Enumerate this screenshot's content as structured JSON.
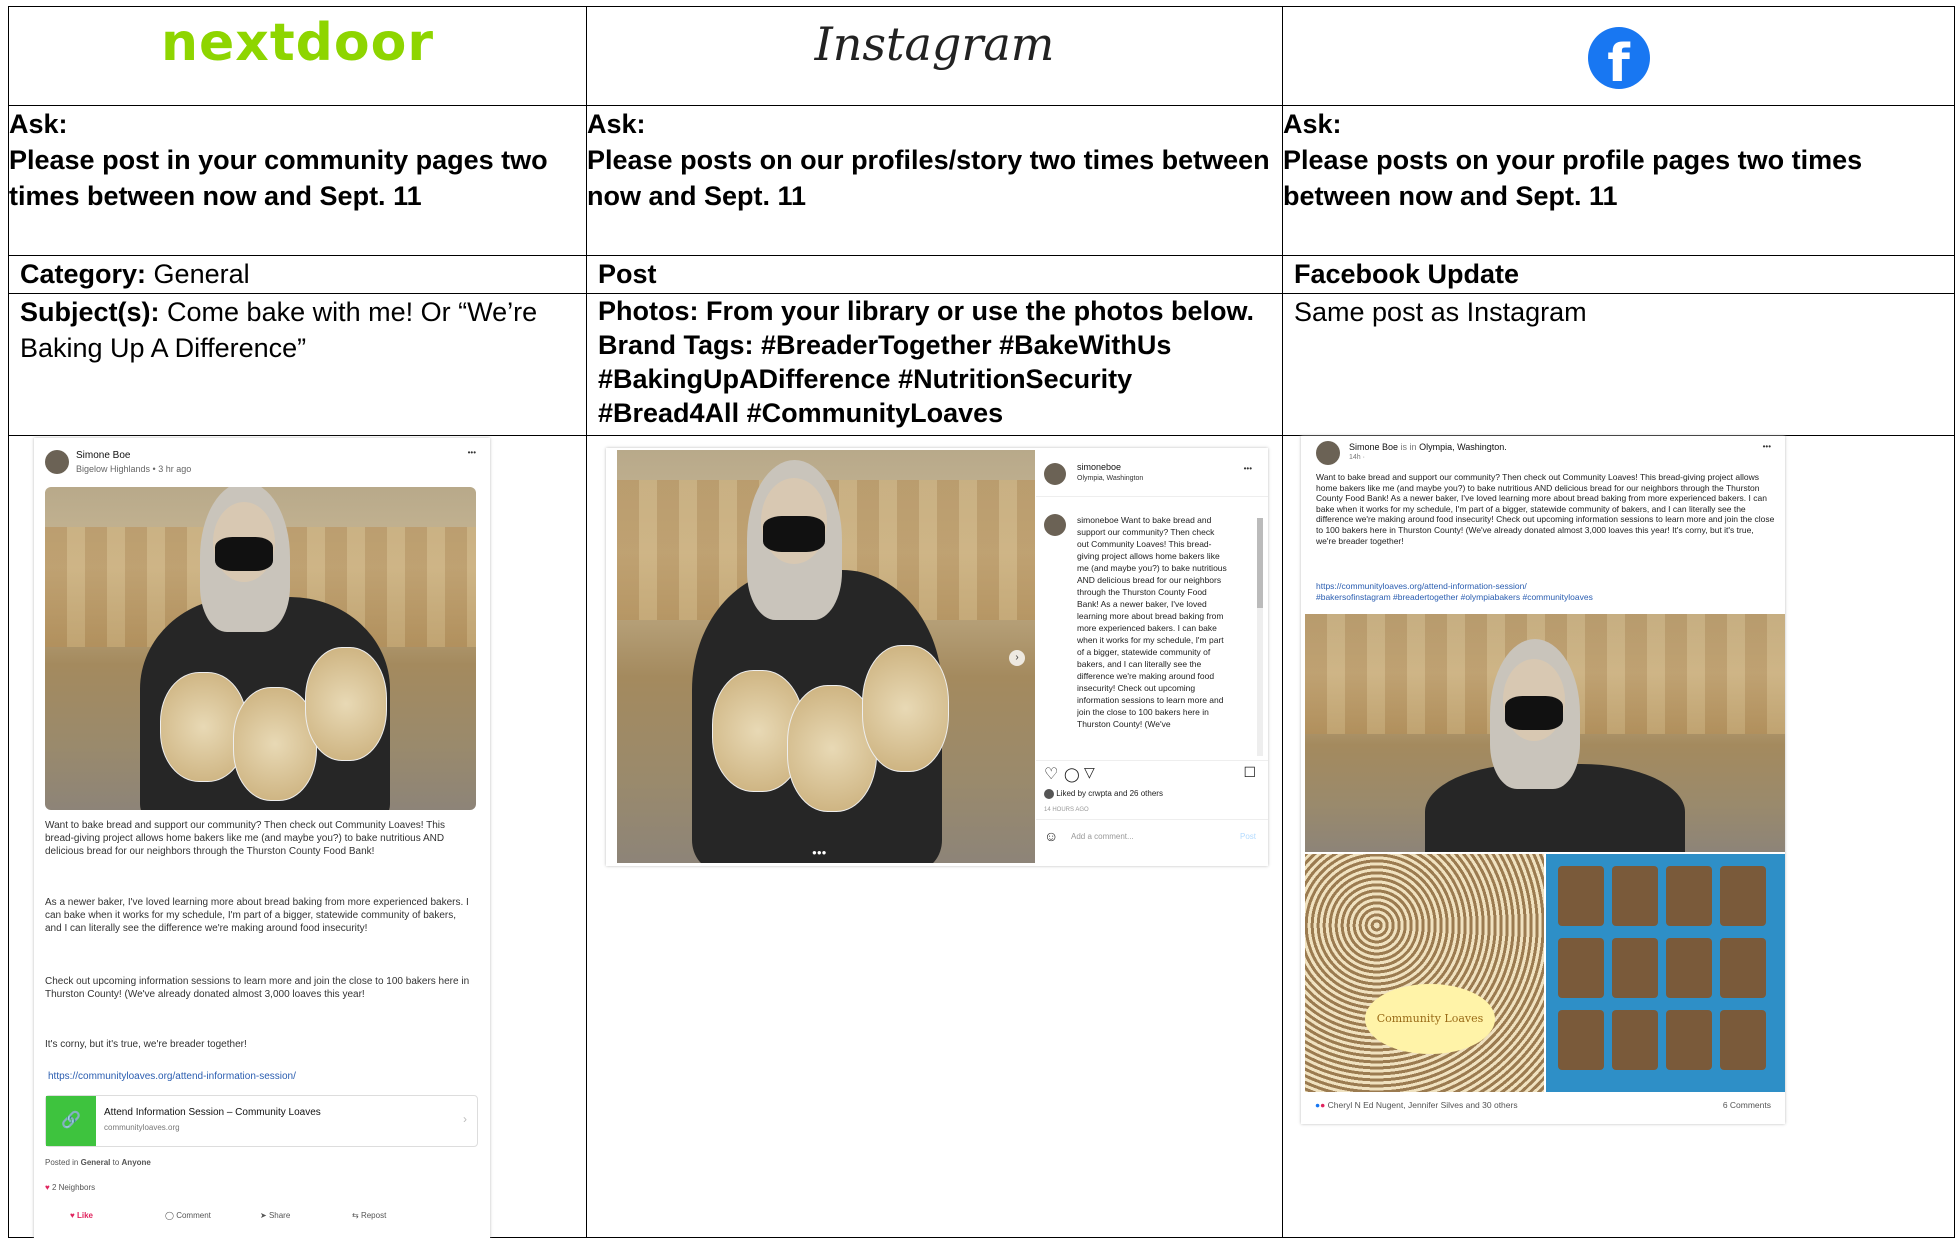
{
  "headers": {
    "nextdoor_logo": "nextdoor",
    "instagram_logo": "Instagram",
    "facebook_logo": "f"
  },
  "asks": {
    "nextdoor": {
      "label": "Ask:",
      "text": "Please post in your community pages two times between now and Sept. 11"
    },
    "instagram": {
      "label": "Ask:",
      "text": "Please posts on our profiles/story two times between now and Sept. 11"
    },
    "facebook": {
      "label": "Ask:",
      "text": "Please posts on your profile pages two times between now and Sept. 11"
    }
  },
  "row3": {
    "nextdoor": {
      "label": "Category:",
      "value": "General"
    },
    "instagram": {
      "label": "Post"
    },
    "facebook": {
      "label": "Facebook Update"
    }
  },
  "row4": {
    "nextdoor": {
      "label": "Subject(s):",
      "value": "Come bake with me! Or “We’re Baking Up A Difference”"
    },
    "instagram": {
      "photos": "Photos: From your library or use the photos below.",
      "tags": "Brand Tags: #BreaderTogether #BakeWithUs #BakingUpADifference #NutritionSecurity #Bread4All #CommunityLoaves"
    },
    "facebook": {
      "text": "Same post as Instagram"
    }
  },
  "nextdoor_post": {
    "author": "Simone Boe",
    "meta": "Bigelow Highlands • 3 hr ago",
    "more": "•••",
    "p1": "Want to bake bread and support our community? Then check out Community Loaves! This bread-giving project allows home bakers like me (and maybe you?) to bake nutritious AND delicious bread for our neighbors through the Thurston County Food Bank!",
    "p2": "As a newer baker, I've loved learning more about bread baking from more experienced bakers. I can bake when it works for my schedule, I'm part of a bigger, statewide community of bakers, and I can literally see the difference we're making around food insecurity!",
    "p3": "Check out upcoming information sessions to learn more and join the close to 100 bakers here in Thurston County! (We've already donated almost 3,000 loaves this year!",
    "p4": "It's corny, but it's true, we're breader together!",
    "url": "https://communityloaves.org/attend-information-session/",
    "link_title": "Attend Information Session – Community Loaves",
    "link_domain": "communityloaves.org",
    "posted_prefix": "Posted in",
    "posted_cat": "General",
    "posted_to": "to",
    "posted_aud": "Anyone",
    "reactions": "2 Neighbors",
    "actions": {
      "like": "Like",
      "comment": "Comment",
      "share": "Share",
      "repost": "Repost"
    }
  },
  "instagram_post": {
    "username": "simoneboe",
    "location": "Olympia, Washington",
    "caption": "simoneboe Want to bake bread and support our community? Then check out Community Loaves! This bread-giving project allows home bakers like me (and maybe you?) to bake nutritious AND delicious bread for our neighbors through the Thurston County Food Bank! As a newer baker, I've loved learning more about bread baking from more experienced bakers. I can bake when it works for my schedule, I'm part of a bigger, statewide community of bakers, and I can literally see the difference we're making around food insecurity! Check out upcoming information sessions to learn more and join the close to 100 bakers here in Thurston County! (We've",
    "liked_by": "Liked by crwpta and 26 others",
    "time": "14 HOURS AGO",
    "add_comment": "Add a comment...",
    "post_btn": "Post"
  },
  "facebook_post": {
    "author": "Simone Boe",
    "is_in": "is in",
    "place": "Olympia, Washington.",
    "time": "14h ·",
    "body": "Want to bake bread and support our community? Then check out Community Loaves! This bread-giving project allows home bakers like me (and maybe you?) to bake nutritious AND delicious bread for our neighbors through the Thurston County Food Bank! As a newer baker, I've loved learning more about bread baking from more experienced bakers. I can bake when it works for my schedule, I'm part of a bigger, statewide community of bakers, and I can literally see the difference we're making around food insecurity! Check out upcoming information sessions to learn more and join the close to 100 bakers here in Thurston County! (We've already donated almost 3,000 loaves this year! It's corny, but it's true, we're breader together!",
    "url": "https://communityloaves.org/attend-information-session/",
    "hashtags": "#bakersofinstagram #breadertogether #olympiabakers #communityloaves",
    "reactions": "Cheryl N Ed Nugent, Jennifer Silves and 30 others",
    "comments": "6 Comments",
    "bag_label": "Community Loaves"
  }
}
